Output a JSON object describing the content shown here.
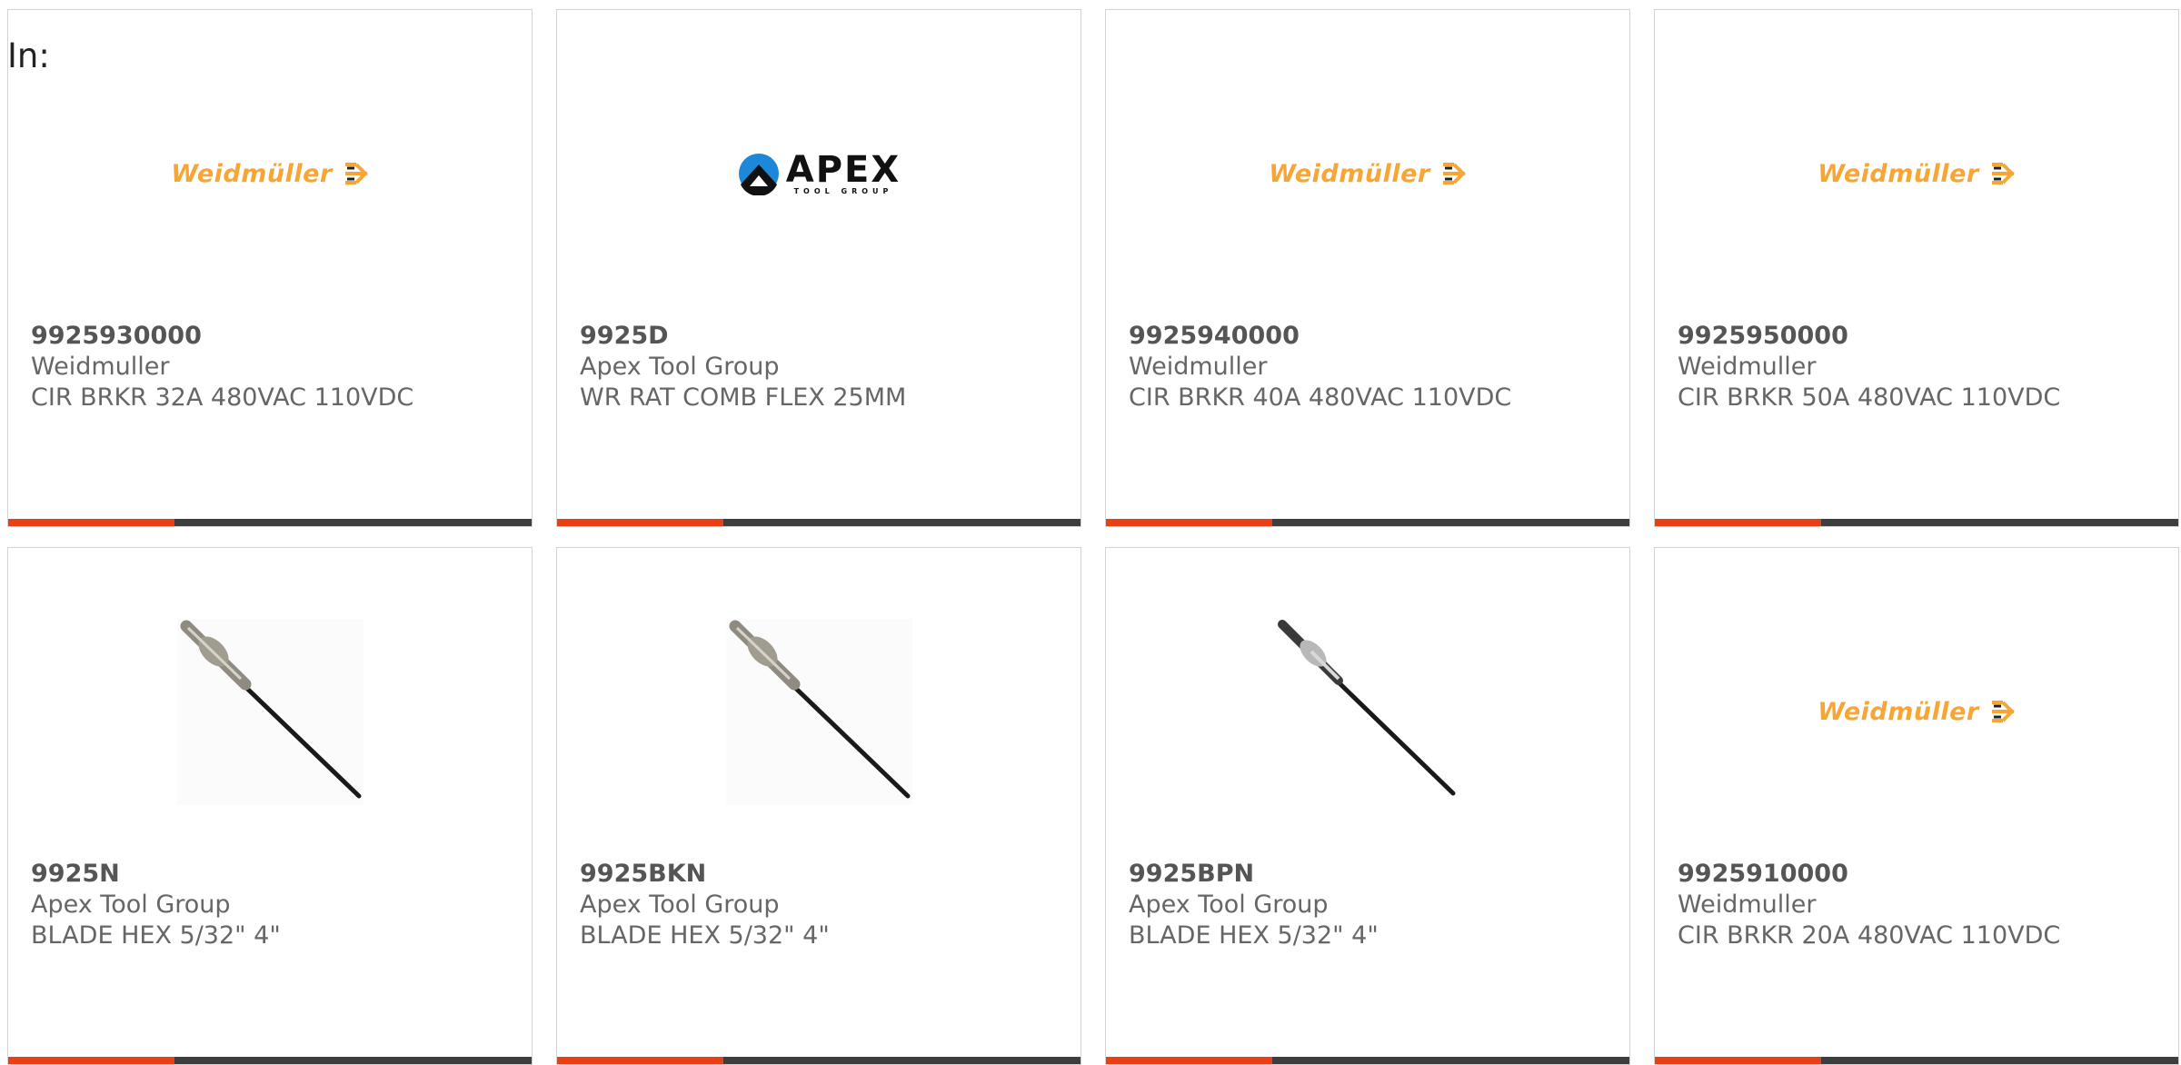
{
  "header": {
    "in_label": "In:"
  },
  "colors": {
    "accent_bar": "#ea3f16",
    "bar": "#3d3d3d",
    "weidmuller_orange": "#f7a535",
    "text": "#666666"
  },
  "brands": {
    "weidmuller": {
      "wordmark": "Weidmüller",
      "icon": "weidmuller-logo-icon"
    },
    "apex": {
      "wordmark": "APEX",
      "subtitle": "TOOL GROUP",
      "icon": "apex-logo-icon"
    }
  },
  "products": [
    {
      "part": "9925930000",
      "manufacturer": "Weidmuller",
      "description": "CIR BRKR 32A 480VAC 110VDC",
      "image": "weidmuller-logo"
    },
    {
      "part": "9925D",
      "manufacturer": "Apex Tool Group",
      "description": "WR RAT COMB FLEX 25MM",
      "image": "apex-logo"
    },
    {
      "part": "9925940000",
      "manufacturer": "Weidmuller",
      "description": "CIR BRKR 40A 480VAC 110VDC",
      "image": "weidmuller-logo"
    },
    {
      "part": "9925950000",
      "manufacturer": "Weidmuller",
      "description": "CIR BRKR 50A 480VAC 110VDC",
      "image": "weidmuller-logo"
    },
    {
      "part": "9925N",
      "manufacturer": "Apex Tool Group",
      "description": "BLADE HEX 5/32\" 4\"",
      "image": "hex-blade-photo"
    },
    {
      "part": "9925BKN",
      "manufacturer": "Apex Tool Group",
      "description": "BLADE HEX 5/32\" 4\"",
      "image": "hex-blade-photo"
    },
    {
      "part": "9925BPN",
      "manufacturer": "Apex Tool Group",
      "description": "BLADE HEX 5/32\" 4\"",
      "image": "hex-blade-photo"
    },
    {
      "part": "9925910000",
      "manufacturer": "Weidmuller",
      "description": "CIR BRKR 20A 480VAC 110VDC",
      "image": "weidmuller-logo"
    }
  ]
}
